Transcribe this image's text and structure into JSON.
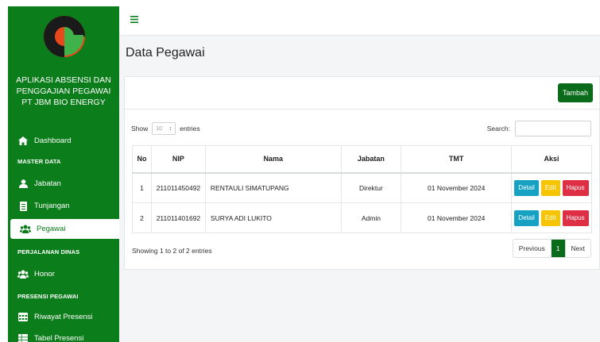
{
  "app": {
    "title_lines": [
      "APLIKASI ABSENSI DAN",
      "PENGGAJIAN PEGAWAI",
      "PT JBM BIO ENERGY"
    ]
  },
  "sidebar": {
    "dashboard": "Dashboard",
    "master_head": "MASTER DATA",
    "jabatan": "Jabatan",
    "tunjangan": "Tunjangan",
    "pegawai": "Pegawai",
    "perjalanan_head": "PERJALANAN DINAS",
    "honor": "Honor",
    "presensi_head": "PRESENSI PEGAWAI",
    "riwayat": "Riwayat Presensi",
    "tabel": "Tabel Presensi"
  },
  "page": {
    "title": "Data Pegawai",
    "add_button": "Tambah"
  },
  "controls": {
    "show_label": "Show",
    "entries_value": "10",
    "entries_label": "entries",
    "search_label": "Search:"
  },
  "table": {
    "headers": [
      "No",
      "NIP",
      "Nama",
      "Jabatan",
      "TMT",
      "Aksi"
    ],
    "rows": [
      [
        "1",
        "211011450492",
        "RENTAULI SIMATUPANG",
        "Direktur",
        "01 November 2024"
      ],
      [
        "2",
        "211011401692",
        "SURYA ADI LUKITO",
        "Admin",
        "01 November 2024"
      ]
    ],
    "actions": {
      "detail": "Detail",
      "edit": "Edit",
      "hapus": "Hapus"
    }
  },
  "footer": {
    "info": "Showing 1 to 2 of 2 entries",
    "previous": "Previous",
    "current_page": "1",
    "next": "Next"
  },
  "colors": {
    "sidebar": "#0b7d1b",
    "primary_button": "#0a6b1a",
    "detail": "#17a2c4",
    "edit": "#f7c400",
    "hapus": "#de2f45"
  },
  "icons": [
    "logo-icon",
    "hamburger-icon",
    "home-icon",
    "user-icon",
    "document-icon",
    "users-icon",
    "calendar-icon",
    "table-icon"
  ]
}
